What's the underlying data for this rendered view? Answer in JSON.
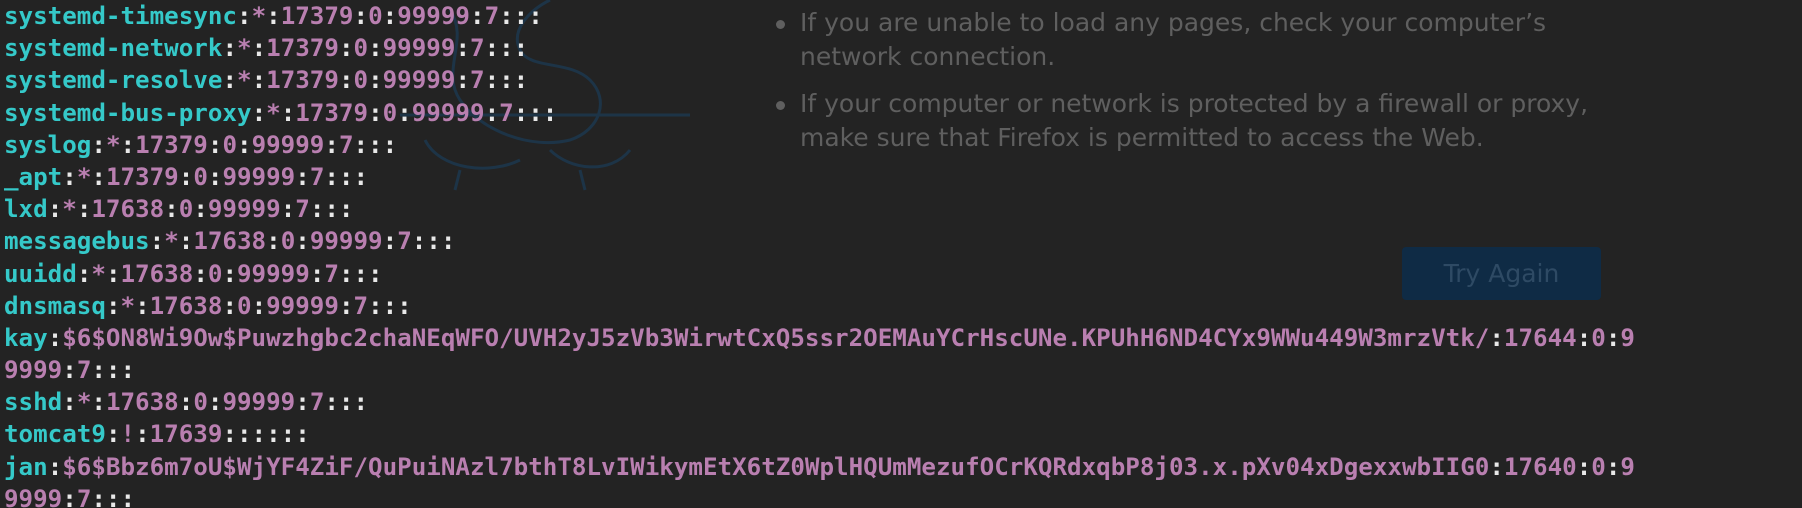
{
  "colors": {
    "background": "#232323",
    "username": "#35c9c9",
    "field": "#b97fb0",
    "separator": "#e8e8e8",
    "background_page_text": "#5f5f5f",
    "background_button": "#0f2b45"
  },
  "background_page": {
    "bullets": [
      "If you are unable to load any pages, check your computer’s network connection.",
      "If your computer or network is protected by a firewall or proxy, make sure that Firefox is permitted to access the Web."
    ],
    "try_again_label": "Try Again",
    "mascot_icon": "firefox-offline-dinosaur-icon"
  },
  "terminal": {
    "lines": [
      {
        "user": "systemd-timesync",
        "rest": [
          ":",
          "*",
          ":",
          "17379",
          ":",
          "0",
          ":",
          "99999",
          ":",
          "7",
          ":::"
        ]
      },
      {
        "user": "systemd-network",
        "rest": [
          ":",
          "*",
          ":",
          "17379",
          ":",
          "0",
          ":",
          "99999",
          ":",
          "7",
          ":::"
        ]
      },
      {
        "user": "systemd-resolve",
        "rest": [
          ":",
          "*",
          ":",
          "17379",
          ":",
          "0",
          ":",
          "99999",
          ":",
          "7",
          ":::"
        ]
      },
      {
        "user": "systemd-bus-proxy",
        "rest": [
          ":",
          "*",
          ":",
          "17379",
          ":",
          "0",
          ":",
          "99999",
          ":",
          "7",
          ":::"
        ]
      },
      {
        "user": "syslog",
        "rest": [
          ":",
          "*",
          ":",
          "17379",
          ":",
          "0",
          ":",
          "99999",
          ":",
          "7",
          ":::"
        ]
      },
      {
        "user": "_apt",
        "rest": [
          ":",
          "*",
          ":",
          "17379",
          ":",
          "0",
          ":",
          "99999",
          ":",
          "7",
          ":::"
        ]
      },
      {
        "user": "lxd",
        "rest": [
          ":",
          "*",
          ":",
          "17638",
          ":",
          "0",
          ":",
          "99999",
          ":",
          "7",
          ":::"
        ]
      },
      {
        "user": "messagebus",
        "rest": [
          ":",
          "*",
          ":",
          "17638",
          ":",
          "0",
          ":",
          "99999",
          ":",
          "7",
          ":::"
        ]
      },
      {
        "user": "uuidd",
        "rest": [
          ":",
          "*",
          ":",
          "17638",
          ":",
          "0",
          ":",
          "99999",
          ":",
          "7",
          ":::"
        ]
      },
      {
        "user": "dnsmasq",
        "rest": [
          ":",
          "*",
          ":",
          "17638",
          ":",
          "0",
          ":",
          "99999",
          ":",
          "7",
          ":::"
        ]
      },
      {
        "user": "kay",
        "rest": [
          ":",
          "$6$ON8Wi9Ow$Puwzhgbc2chaNEqWFO/UVH2yJ5zVb3WirwtCxQ5ssr2OEMAuYCrHscUNe.KPUhH6ND4CYx9WWu449W3mrzVtk/",
          ":",
          "17644",
          ":",
          "0",
          ":",
          "9"
        ]
      },
      {
        "user": "",
        "rest": [
          "9999",
          ":",
          "7",
          ":::"
        ]
      },
      {
        "user": "sshd",
        "rest": [
          ":",
          "*",
          ":",
          "17638",
          ":",
          "0",
          ":",
          "99999",
          ":",
          "7",
          ":::"
        ]
      },
      {
        "user": "tomcat9",
        "rest": [
          ":",
          "!",
          ":",
          "17639",
          "::::::"
        ]
      },
      {
        "user": "jan",
        "rest": [
          ":",
          "$6$Bbz6m7oU$WjYF4ZiF/QuPuiNAzl7bthT8LvIWikymEtX6tZ0WplHQUmMezufOCrKQRdxqbP8j03.x.pXv04xDgexxwbIIG0",
          ":",
          "17640",
          ":",
          "0",
          ":",
          "9"
        ]
      },
      {
        "user": "",
        "rest": [
          "9999",
          ":",
          "7",
          ":::"
        ]
      }
    ]
  }
}
